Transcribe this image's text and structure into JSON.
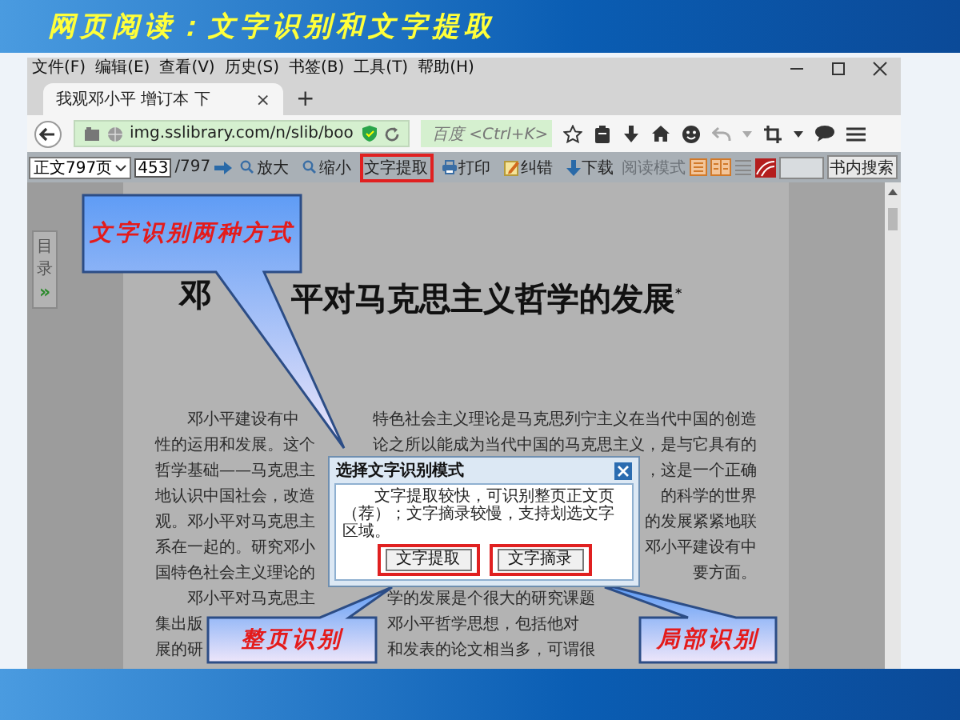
{
  "slide": {
    "title": "网页阅读：文字识别和文字提取"
  },
  "menu": [
    "文件(F)",
    "编辑(E)",
    "查看(V)",
    "历史(S)",
    "书签(B)",
    "工具(T)",
    "帮助(H)"
  ],
  "tabs": [
    {
      "title": "我观邓小平 增订本 下",
      "close": "×",
      "selected": true
    }
  ],
  "new_tab": "+",
  "address": {
    "value": "img.sslibrary.com/n/slib/boo"
  },
  "search": {
    "placeholder": "百度 <Ctrl+K>"
  },
  "reader_toolbar": {
    "page_select": "正文797页",
    "page_input": "453",
    "page_total": "/797",
    "buttons": [
      {
        "label": "放大",
        "kind": "zoom_in",
        "highlighted": false
      },
      {
        "label": "缩小",
        "kind": "zoom_out",
        "highlighted": false
      },
      {
        "label": "文字提取",
        "kind": "text",
        "highlighted": true
      },
      {
        "label": "打印",
        "kind": "print",
        "highlighted": false
      },
      {
        "label": "纠错",
        "kind": "correct",
        "highlighted": false
      },
      {
        "label": "下载",
        "kind": "download",
        "highlighted": false
      }
    ],
    "reading_mode": "阅读模式",
    "search_button": "书内搜索"
  },
  "sidebar": {
    "toc_label": [
      "目",
      "录"
    ],
    "expand": "»"
  },
  "book": {
    "title_parts": [
      "邓",
      "平对马克思主义哲学的发展"
    ],
    "title_mark": "*",
    "paragraphs": [
      {
        "lines": [
          [
            "邓小平建设有中",
            "特色社会主义理论是马克思列宁主义在当代中国的创造"
          ],
          [
            "性的运用和发展。这个",
            "论之所以能成为当代中国的马克思主义，是与它具有的"
          ],
          [
            "哲学基础——马克思主",
            "，这是一个正确"
          ],
          [
            "地认识中国社会，改造",
            "的科学的世界"
          ],
          [
            "观。邓小平对马克思主",
            "的发展紧紧地联"
          ],
          [
            "系在一起的。研究邓小",
            "邓小平建设有中"
          ],
          [
            "国特色社会主义理论的",
            "要方面。"
          ]
        ]
      },
      {
        "lines": [
          [
            "邓小平对马克思主",
            "学的发展是个很大的研究课题"
          ],
          [
            "集出版",
            "邓小平哲学思想，包括他对"
          ],
          [
            "展的研",
            "和发表的论文相当多，可谓很"
          ]
        ]
      }
    ]
  },
  "dialog": {
    "title": "选择文字识别模式",
    "message": "文字提取较快，可识别整页正文页（荐）；文字摘录较慢，支持划选文字区域。",
    "buttons": [
      {
        "label": "文字提取",
        "highlighted": true
      },
      {
        "label": "文字摘录",
        "highlighted": true
      }
    ]
  },
  "callouts": [
    {
      "text": "文字识别两种方式"
    },
    {
      "text": "整页识别"
    },
    {
      "text": "局部识别"
    }
  ]
}
